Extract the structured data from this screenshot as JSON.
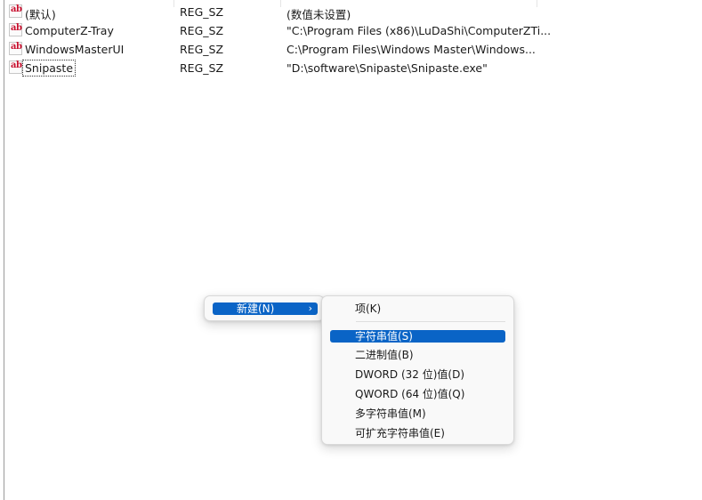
{
  "registry_values": [
    {
      "name": "(默认)",
      "type": "REG_SZ",
      "data": "(数值未设置)"
    },
    {
      "name": "ComputerZ-Tray",
      "type": "REG_SZ",
      "data": "\"C:\\Program Files (x86)\\LuDaShi\\ComputerZTi..."
    },
    {
      "name": "WindowsMasterUI",
      "type": "REG_SZ",
      "data": "C:\\Program Files\\Windows Master\\Windows..."
    },
    {
      "name": "Snipaste",
      "type": "REG_SZ",
      "data": "\"D:\\software\\Snipaste\\Snipaste.exe\""
    }
  ],
  "value_icon_text": "ab",
  "context_menu": {
    "new_label": "新建(N)",
    "submenu_arrow": "›"
  },
  "new_submenu": {
    "key": "项(K)",
    "string_value": "字符串值(S)",
    "binary_value": "二进制值(B)",
    "dword_value": "DWORD (32 位)值(D)",
    "qword_value": "QWORD (64 位)值(Q)",
    "multi_string_value": "多字符串值(M)",
    "expandable_string_value": "可扩充字符串值(E)"
  },
  "colors": {
    "highlight": "#0a64c6",
    "icon_text": "#c8102e",
    "menu_bg": "#f9f9f9"
  }
}
